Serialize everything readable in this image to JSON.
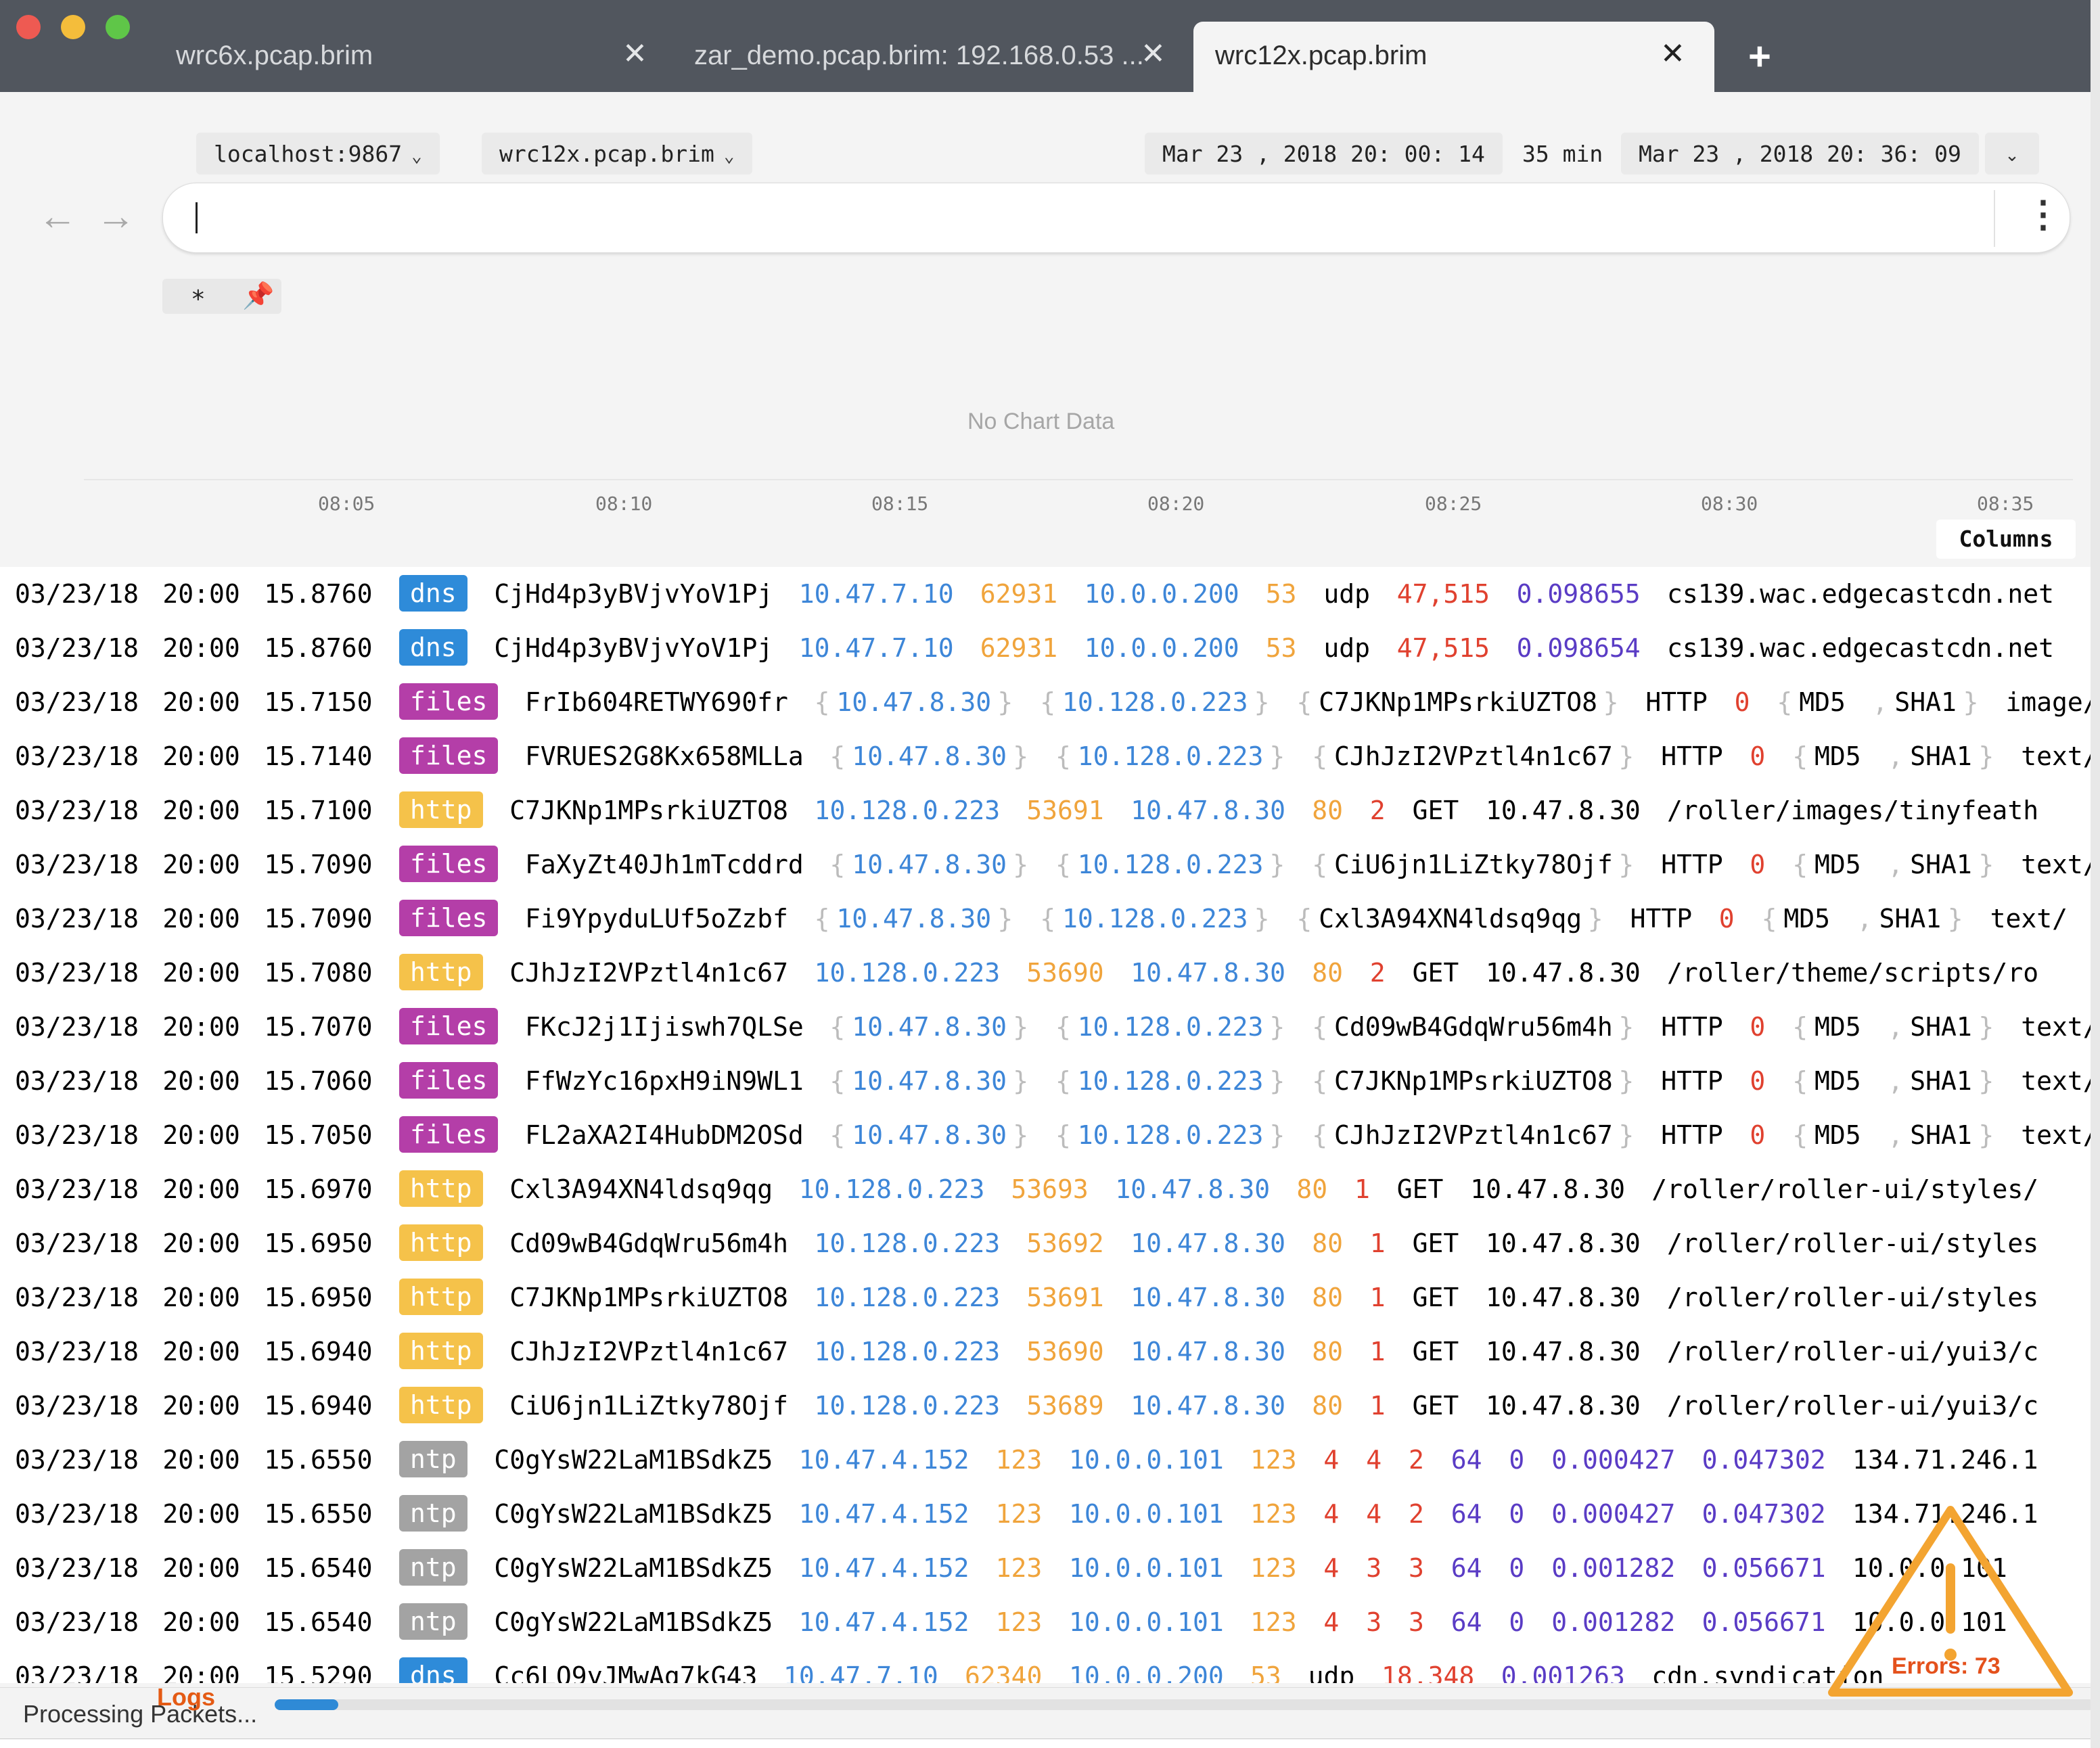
{
  "window": {
    "tabs": [
      {
        "label": "wrc6x.pcap.brim",
        "active": false
      },
      {
        "label": "zar_demo.pcap.brim: 192.168.0.53 ...",
        "active": false
      },
      {
        "label": "wrc12x.pcap.brim",
        "active": true
      }
    ],
    "close_glyph": "✕",
    "new_tab_glyph": "+"
  },
  "header": {
    "host": "localhost:9867",
    "space": "wrc12x.pcap.brim",
    "span_from": "Mar 23 , 2018 20: 00: 14",
    "duration": "35 min",
    "span_to": "Mar 23 , 2018 20: 36: 09",
    "back_icon": "arrow-left-icon",
    "forward_icon": "arrow-right-icon",
    "search_value": "",
    "menu_icon": "vertical-dots-icon",
    "pinned_filter": "*"
  },
  "chart": {
    "no_data": "No Chart Data",
    "ticks": [
      "08:05",
      "08:10",
      "08:15",
      "08:20",
      "08:25",
      "08:30",
      "08:35"
    ],
    "columns_label": "Columns"
  },
  "colors": {
    "dns": "#2e8bd9",
    "files": "#b43ea8",
    "http": "#f5c24a",
    "ntp": "#a3a3a3",
    "ip": "#3d86d8",
    "port": "#f0a43c",
    "count": "#e0412f",
    "duration": "#5a3cc5"
  },
  "rows": [
    {
      "date": "03/23/18",
      "time": "20:00",
      "sec": "15.8760",
      "path": "dns",
      "f": [
        [
          "CjHd4p3yBVjvYoV1Pj",
          ""
        ],
        [
          "10.47.7.10",
          "blue"
        ],
        [
          "62931",
          "orange"
        ],
        [
          "10.0.0.200",
          "blue"
        ],
        [
          "53",
          "orange"
        ],
        [
          "udp",
          ""
        ],
        [
          "47,515",
          "red"
        ],
        [
          "0.098655",
          "purple"
        ],
        [
          "cs139.wac.edgecastcdn.net",
          ""
        ]
      ]
    },
    {
      "date": "03/23/18",
      "time": "20:00",
      "sec": "15.8760",
      "path": "dns",
      "f": [
        [
          "CjHd4p3yBVjvYoV1Pj",
          ""
        ],
        [
          "10.47.7.10",
          "blue"
        ],
        [
          "62931",
          "orange"
        ],
        [
          "10.0.0.200",
          "blue"
        ],
        [
          "53",
          "orange"
        ],
        [
          "udp",
          ""
        ],
        [
          "47,515",
          "red"
        ],
        [
          "0.098654",
          "purple"
        ],
        [
          "cs139.wac.edgecastcdn.net",
          ""
        ]
      ]
    },
    {
      "date": "03/23/18",
      "time": "20:00",
      "sec": "15.7150",
      "path": "files",
      "f": [
        [
          "FrIb604RETWY690fr",
          ""
        ],
        [
          "{",
          "gray"
        ],
        [
          "10.47.8.30",
          "blue"
        ],
        [
          "}",
          "gray"
        ],
        [
          "{",
          "gray"
        ],
        [
          "10.128.0.223",
          "blue"
        ],
        [
          "}",
          "gray"
        ],
        [
          "{",
          "gray"
        ],
        [
          "C7JKNp1MPsrkiUZTO8",
          ""
        ],
        [
          "}",
          "gray"
        ],
        [
          "HTTP",
          ""
        ],
        [
          "0",
          "red"
        ],
        [
          "{",
          "gray"
        ],
        [
          "MD5",
          ""
        ],
        [
          ",",
          "gray"
        ],
        [
          "SHA1",
          ""
        ],
        [
          "}",
          "gray"
        ],
        [
          "image/",
          ""
        ]
      ]
    },
    {
      "date": "03/23/18",
      "time": "20:00",
      "sec": "15.7140",
      "path": "files",
      "f": [
        [
          "FVRUES2G8Kx658MLLa",
          ""
        ],
        [
          "{",
          "gray"
        ],
        [
          "10.47.8.30",
          "blue"
        ],
        [
          "}",
          "gray"
        ],
        [
          "{",
          "gray"
        ],
        [
          "10.128.0.223",
          "blue"
        ],
        [
          "}",
          "gray"
        ],
        [
          "{",
          "gray"
        ],
        [
          "CJhJzI2VPztl4n1c67",
          ""
        ],
        [
          "}",
          "gray"
        ],
        [
          "HTTP",
          ""
        ],
        [
          "0",
          "red"
        ],
        [
          "{",
          "gray"
        ],
        [
          "MD5",
          ""
        ],
        [
          ",",
          "gray"
        ],
        [
          "SHA1",
          ""
        ],
        [
          "}",
          "gray"
        ],
        [
          "text/",
          ""
        ]
      ]
    },
    {
      "date": "03/23/18",
      "time": "20:00",
      "sec": "15.7100",
      "path": "http",
      "f": [
        [
          "C7JKNp1MPsrkiUZTO8",
          ""
        ],
        [
          "10.128.0.223",
          "blue"
        ],
        [
          "53691",
          "orange"
        ],
        [
          "10.47.8.30",
          "blue"
        ],
        [
          "80",
          "orange"
        ],
        [
          "2",
          "red"
        ],
        [
          "GET",
          ""
        ],
        [
          "10.47.8.30",
          ""
        ],
        [
          "/roller/images/tinyfeath",
          ""
        ]
      ]
    },
    {
      "date": "03/23/18",
      "time": "20:00",
      "sec": "15.7090",
      "path": "files",
      "f": [
        [
          "FaXyZt40Jh1mTcddrd",
          ""
        ],
        [
          "{",
          "gray"
        ],
        [
          "10.47.8.30",
          "blue"
        ],
        [
          "}",
          "gray"
        ],
        [
          "{",
          "gray"
        ],
        [
          "10.128.0.223",
          "blue"
        ],
        [
          "}",
          "gray"
        ],
        [
          "{",
          "gray"
        ],
        [
          "CiU6jn1LiZtky78Ojf",
          ""
        ],
        [
          "}",
          "gray"
        ],
        [
          "HTTP",
          ""
        ],
        [
          "0",
          "red"
        ],
        [
          "{",
          "gray"
        ],
        [
          "MD5",
          ""
        ],
        [
          ",",
          "gray"
        ],
        [
          "SHA1",
          ""
        ],
        [
          "}",
          "gray"
        ],
        [
          "text/",
          ""
        ]
      ]
    },
    {
      "date": "03/23/18",
      "time": "20:00",
      "sec": "15.7090",
      "path": "files",
      "f": [
        [
          "Fi9YpyduLUf5oZzbf",
          ""
        ],
        [
          "{",
          "gray"
        ],
        [
          "10.47.8.30",
          "blue"
        ],
        [
          "}",
          "gray"
        ],
        [
          "{",
          "gray"
        ],
        [
          "10.128.0.223",
          "blue"
        ],
        [
          "}",
          "gray"
        ],
        [
          "{",
          "gray"
        ],
        [
          "Cxl3A94XN4ldsq9qg",
          ""
        ],
        [
          "}",
          "gray"
        ],
        [
          "HTTP",
          ""
        ],
        [
          "0",
          "red"
        ],
        [
          "{",
          "gray"
        ],
        [
          "MD5",
          ""
        ],
        [
          ",",
          "gray"
        ],
        [
          "SHA1",
          ""
        ],
        [
          "}",
          "gray"
        ],
        [
          "text/",
          ""
        ]
      ]
    },
    {
      "date": "03/23/18",
      "time": "20:00",
      "sec": "15.7080",
      "path": "http",
      "f": [
        [
          "CJhJzI2VPztl4n1c67",
          ""
        ],
        [
          "10.128.0.223",
          "blue"
        ],
        [
          "53690",
          "orange"
        ],
        [
          "10.47.8.30",
          "blue"
        ],
        [
          "80",
          "orange"
        ],
        [
          "2",
          "red"
        ],
        [
          "GET",
          ""
        ],
        [
          "10.47.8.30",
          ""
        ],
        [
          "/roller/theme/scripts/ro",
          ""
        ]
      ]
    },
    {
      "date": "03/23/18",
      "time": "20:00",
      "sec": "15.7070",
      "path": "files",
      "f": [
        [
          "FKcJ2j1Ijiswh7QLSe",
          ""
        ],
        [
          "{",
          "gray"
        ],
        [
          "10.47.8.30",
          "blue"
        ],
        [
          "}",
          "gray"
        ],
        [
          "{",
          "gray"
        ],
        [
          "10.128.0.223",
          "blue"
        ],
        [
          "}",
          "gray"
        ],
        [
          "{",
          "gray"
        ],
        [
          "Cd09wB4GdqWru56m4h",
          ""
        ],
        [
          "}",
          "gray"
        ],
        [
          "HTTP",
          ""
        ],
        [
          "0",
          "red"
        ],
        [
          "{",
          "gray"
        ],
        [
          "MD5",
          ""
        ],
        [
          ",",
          "gray"
        ],
        [
          "SHA1",
          ""
        ],
        [
          "}",
          "gray"
        ],
        [
          "text/",
          ""
        ]
      ]
    },
    {
      "date": "03/23/18",
      "time": "20:00",
      "sec": "15.7060",
      "path": "files",
      "f": [
        [
          "FfWzYc16pxH9iN9WL1",
          ""
        ],
        [
          "{",
          "gray"
        ],
        [
          "10.47.8.30",
          "blue"
        ],
        [
          "}",
          "gray"
        ],
        [
          "{",
          "gray"
        ],
        [
          "10.128.0.223",
          "blue"
        ],
        [
          "}",
          "gray"
        ],
        [
          "{",
          "gray"
        ],
        [
          "C7JKNp1MPsrkiUZTO8",
          ""
        ],
        [
          "}",
          "gray"
        ],
        [
          "HTTP",
          ""
        ],
        [
          "0",
          "red"
        ],
        [
          "{",
          "gray"
        ],
        [
          "MD5",
          ""
        ],
        [
          ",",
          "gray"
        ],
        [
          "SHA1",
          ""
        ],
        [
          "}",
          "gray"
        ],
        [
          "text/",
          ""
        ]
      ]
    },
    {
      "date": "03/23/18",
      "time": "20:00",
      "sec": "15.7050",
      "path": "files",
      "f": [
        [
          "FL2aXA2I4HubDM2OSd",
          ""
        ],
        [
          "{",
          "gray"
        ],
        [
          "10.47.8.30",
          "blue"
        ],
        [
          "}",
          "gray"
        ],
        [
          "{",
          "gray"
        ],
        [
          "10.128.0.223",
          "blue"
        ],
        [
          "}",
          "gray"
        ],
        [
          "{",
          "gray"
        ],
        [
          "CJhJzI2VPztl4n1c67",
          ""
        ],
        [
          "}",
          "gray"
        ],
        [
          "HTTP",
          ""
        ],
        [
          "0",
          "red"
        ],
        [
          "{",
          "gray"
        ],
        [
          "MD5",
          ""
        ],
        [
          ",",
          "gray"
        ],
        [
          "SHA1",
          ""
        ],
        [
          "}",
          "gray"
        ],
        [
          "text/",
          ""
        ]
      ]
    },
    {
      "date": "03/23/18",
      "time": "20:00",
      "sec": "15.6970",
      "path": "http",
      "f": [
        [
          "Cxl3A94XN4ldsq9qg",
          ""
        ],
        [
          "10.128.0.223",
          "blue"
        ],
        [
          "53693",
          "orange"
        ],
        [
          "10.47.8.30",
          "blue"
        ],
        [
          "80",
          "orange"
        ],
        [
          "1",
          "red"
        ],
        [
          "GET",
          ""
        ],
        [
          "10.47.8.30",
          ""
        ],
        [
          "/roller/roller-ui/styles/",
          ""
        ]
      ]
    },
    {
      "date": "03/23/18",
      "time": "20:00",
      "sec": "15.6950",
      "path": "http",
      "f": [
        [
          "Cd09wB4GdqWru56m4h",
          ""
        ],
        [
          "10.128.0.223",
          "blue"
        ],
        [
          "53692",
          "orange"
        ],
        [
          "10.47.8.30",
          "blue"
        ],
        [
          "80",
          "orange"
        ],
        [
          "1",
          "red"
        ],
        [
          "GET",
          ""
        ],
        [
          "10.47.8.30",
          ""
        ],
        [
          "/roller/roller-ui/styles",
          ""
        ]
      ]
    },
    {
      "date": "03/23/18",
      "time": "20:00",
      "sec": "15.6950",
      "path": "http",
      "f": [
        [
          "C7JKNp1MPsrkiUZTO8",
          ""
        ],
        [
          "10.128.0.223",
          "blue"
        ],
        [
          "53691",
          "orange"
        ],
        [
          "10.47.8.30",
          "blue"
        ],
        [
          "80",
          "orange"
        ],
        [
          "1",
          "red"
        ],
        [
          "GET",
          ""
        ],
        [
          "10.47.8.30",
          ""
        ],
        [
          "/roller/roller-ui/styles",
          ""
        ]
      ]
    },
    {
      "date": "03/23/18",
      "time": "20:00",
      "sec": "15.6940",
      "path": "http",
      "f": [
        [
          "CJhJzI2VPztl4n1c67",
          ""
        ],
        [
          "10.128.0.223",
          "blue"
        ],
        [
          "53690",
          "orange"
        ],
        [
          "10.47.8.30",
          "blue"
        ],
        [
          "80",
          "orange"
        ],
        [
          "1",
          "red"
        ],
        [
          "GET",
          ""
        ],
        [
          "10.47.8.30",
          ""
        ],
        [
          "/roller/roller-ui/yui3/c",
          ""
        ]
      ]
    },
    {
      "date": "03/23/18",
      "time": "20:00",
      "sec": "15.6940",
      "path": "http",
      "f": [
        [
          "CiU6jn1LiZtky78Ojf",
          ""
        ],
        [
          "10.128.0.223",
          "blue"
        ],
        [
          "53689",
          "orange"
        ],
        [
          "10.47.8.30",
          "blue"
        ],
        [
          "80",
          "orange"
        ],
        [
          "1",
          "red"
        ],
        [
          "GET",
          ""
        ],
        [
          "10.47.8.30",
          ""
        ],
        [
          "/roller/roller-ui/yui3/c",
          ""
        ]
      ]
    },
    {
      "date": "03/23/18",
      "time": "20:00",
      "sec": "15.6550",
      "path": "ntp",
      "f": [
        [
          "C0gYsW22LaM1BSdkZ5",
          ""
        ],
        [
          "10.47.4.152",
          "blue"
        ],
        [
          "123",
          "orange"
        ],
        [
          "10.0.0.101",
          "blue"
        ],
        [
          "123",
          "orange"
        ],
        [
          "4",
          "red"
        ],
        [
          "4",
          "red"
        ],
        [
          "2",
          "red"
        ],
        [
          "64",
          "purple"
        ],
        [
          "0",
          "purple"
        ],
        [
          "0.000427",
          "purple"
        ],
        [
          "0.047302",
          "purple"
        ],
        [
          "134.71.246.1",
          ""
        ]
      ]
    },
    {
      "date": "03/23/18",
      "time": "20:00",
      "sec": "15.6550",
      "path": "ntp",
      "f": [
        [
          "C0gYsW22LaM1BSdkZ5",
          ""
        ],
        [
          "10.47.4.152",
          "blue"
        ],
        [
          "123",
          "orange"
        ],
        [
          "10.0.0.101",
          "blue"
        ],
        [
          "123",
          "orange"
        ],
        [
          "4",
          "red"
        ],
        [
          "4",
          "red"
        ],
        [
          "2",
          "red"
        ],
        [
          "64",
          "purple"
        ],
        [
          "0",
          "purple"
        ],
        [
          "0.000427",
          "purple"
        ],
        [
          "0.047302",
          "purple"
        ],
        [
          "134.71.246.1",
          ""
        ]
      ]
    },
    {
      "date": "03/23/18",
      "time": "20:00",
      "sec": "15.6540",
      "path": "ntp",
      "f": [
        [
          "C0gYsW22LaM1BSdkZ5",
          ""
        ],
        [
          "10.47.4.152",
          "blue"
        ],
        [
          "123",
          "orange"
        ],
        [
          "10.0.0.101",
          "blue"
        ],
        [
          "123",
          "orange"
        ],
        [
          "4",
          "red"
        ],
        [
          "3",
          "red"
        ],
        [
          "3",
          "red"
        ],
        [
          "64",
          "purple"
        ],
        [
          "0",
          "purple"
        ],
        [
          "0.001282",
          "purple"
        ],
        [
          "0.056671",
          "purple"
        ],
        [
          "10.0.0.101",
          ""
        ]
      ]
    },
    {
      "date": "03/23/18",
      "time": "20:00",
      "sec": "15.6540",
      "path": "ntp",
      "f": [
        [
          "C0gYsW22LaM1BSdkZ5",
          ""
        ],
        [
          "10.47.4.152",
          "blue"
        ],
        [
          "123",
          "orange"
        ],
        [
          "10.0.0.101",
          "blue"
        ],
        [
          "123",
          "orange"
        ],
        [
          "4",
          "red"
        ],
        [
          "3",
          "red"
        ],
        [
          "3",
          "red"
        ],
        [
          "64",
          "purple"
        ],
        [
          "0",
          "purple"
        ],
        [
          "0.001282",
          "purple"
        ],
        [
          "0.056671",
          "purple"
        ],
        [
          "10.0.0.101",
          ""
        ]
      ]
    },
    {
      "date": "03/23/18",
      "time": "20:00",
      "sec": "15.5290",
      "path": "dns",
      "f": [
        [
          "Cc6LO9yJMwAg7kG43",
          ""
        ],
        [
          "10.47.7.10",
          "blue"
        ],
        [
          "62340",
          "orange"
        ],
        [
          "10.0.0.200",
          "blue"
        ],
        [
          "53",
          "orange"
        ],
        [
          "udp",
          ""
        ],
        [
          "18,348",
          "red"
        ],
        [
          "0.001263",
          "purple"
        ],
        [
          "cdn.syndication",
          ""
        ]
      ]
    }
  ],
  "status": {
    "text": "Processing Packets...",
    "logs_label": "Logs",
    "errors_label": "Errors: 73",
    "progress": 0.035,
    "warning_icon": "warning-triangle-icon"
  }
}
